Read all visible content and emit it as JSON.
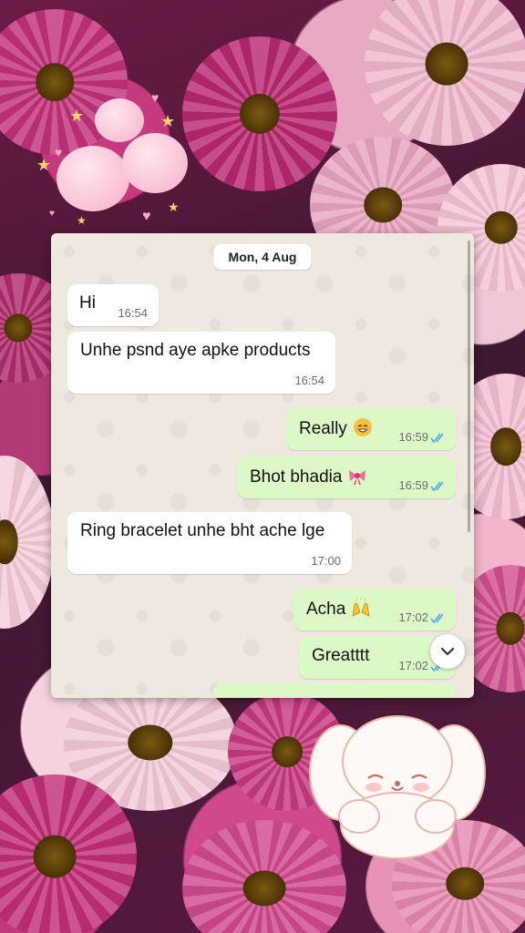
{
  "chat": {
    "date_separator": "Mon, 4 Aug",
    "messages": [
      {
        "direction": "incoming",
        "text": "Hi",
        "time": "16:54"
      },
      {
        "direction": "incoming",
        "text": "Unhe psnd aye apke products",
        "time": "16:54"
      },
      {
        "direction": "outgoing",
        "text": "Really",
        "emoji": "grinning-face",
        "time": "16:59",
        "status": "read"
      },
      {
        "direction": "outgoing",
        "text": "Bhot bhadia",
        "emoji": "ribbon",
        "time": "16:59",
        "status": "read"
      },
      {
        "direction": "incoming",
        "text": "Ring bracelet unhe bht ache lge",
        "time": "17:00"
      },
      {
        "direction": "outgoing",
        "text": "Acha",
        "emoji": "raising-hands",
        "time": "17:02",
        "status": "read"
      },
      {
        "direction": "outgoing",
        "text": "Greatttt",
        "time": "17:02",
        "status": "read"
      }
    ]
  },
  "colors": {
    "incoming_bubble": "#ffffff",
    "outgoing_bubble": "#dcf8c6",
    "read_ticks": "#4fa8e8",
    "chat_background": "#efe8df"
  },
  "icons": {
    "read_receipt": "double-check-icon",
    "scroll_down": "chevron-down-icon"
  }
}
